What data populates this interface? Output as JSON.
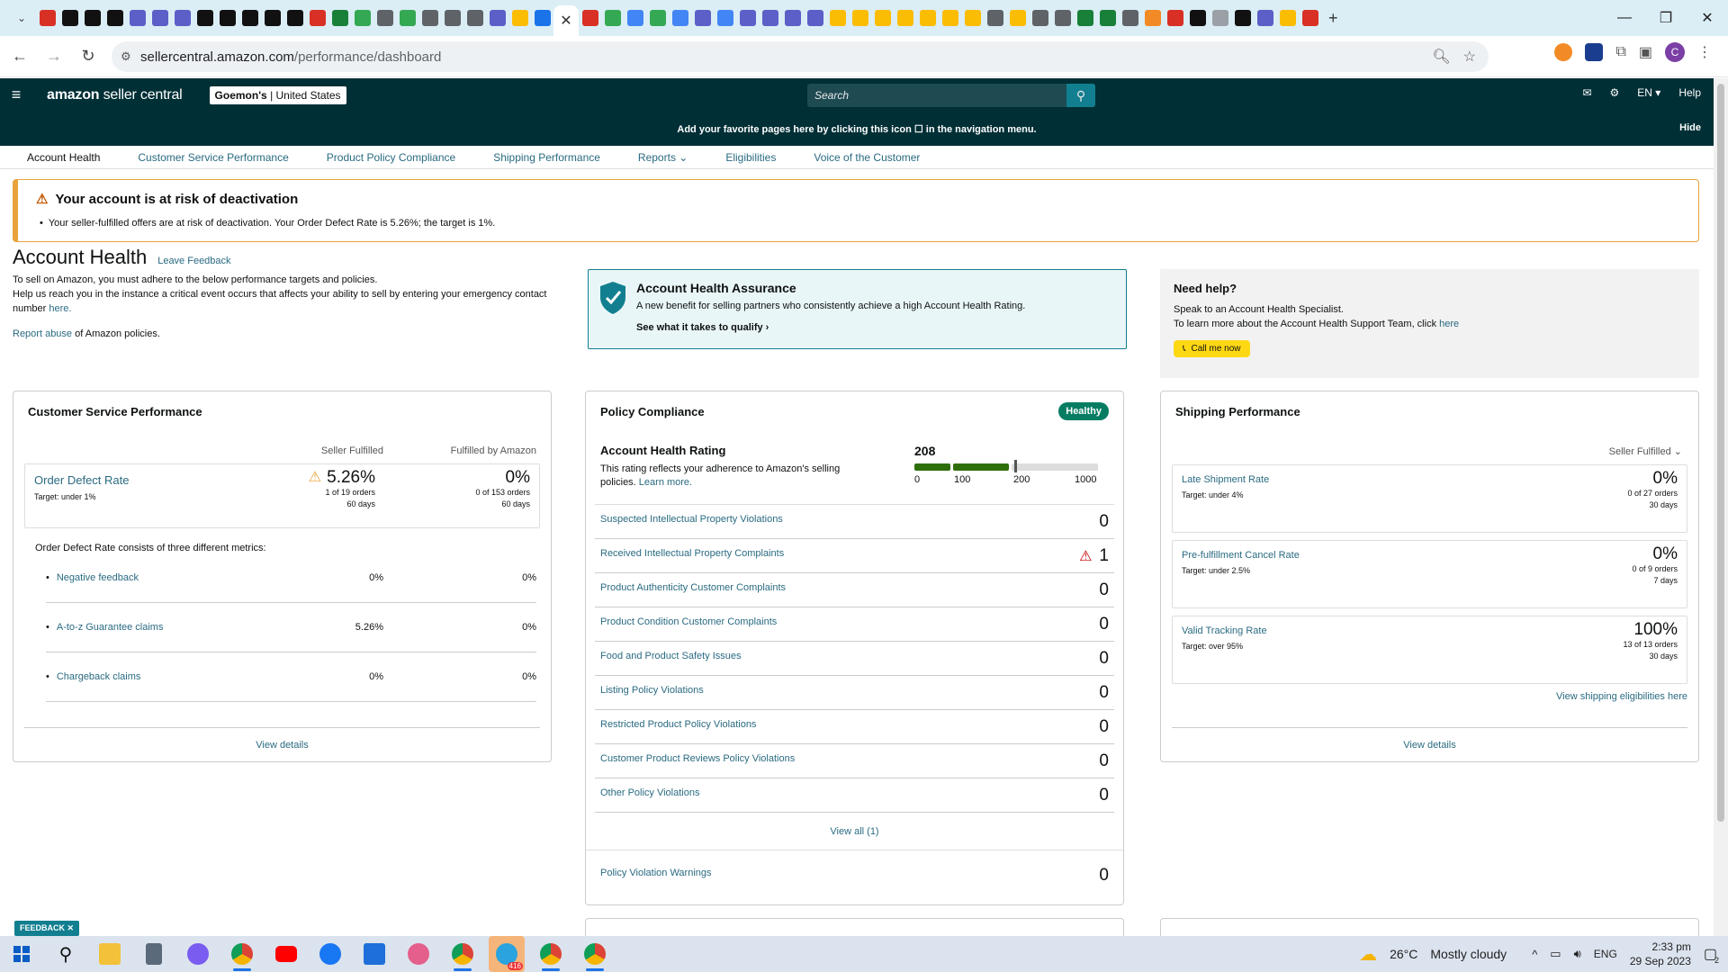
{
  "browser": {
    "active_tab_close": "✕",
    "url_host": "sellercentral.amazon.com",
    "url_path": "/performance/dashboard",
    "profile_initial": "C"
  },
  "header": {
    "logo_bold": "amazon",
    "logo_rest": " seller central",
    "store_name": "Goemon's",
    "store_region": " | United States",
    "search_placeholder": "Search",
    "lang": "EN ▾",
    "help": "Help",
    "fav_message": "Add your favorite pages here by clicking this icon ☐ in the navigation menu.",
    "fav_hide": "Hide"
  },
  "subnav": [
    "Account Health",
    "Customer Service Performance",
    "Product Policy Compliance",
    "Shipping Performance",
    "Reports  ⌄",
    "Eligibilities",
    "Voice of the Customer"
  ],
  "alert": {
    "title": "Your account is at risk of deactivation",
    "text": "Your seller-fulfilled offers are at risk of deactivation. Your Order Defect Rate is 5.26%; the target is 1%."
  },
  "account_health": {
    "title": "Account Health",
    "leave_feedback": "Leave Feedback",
    "desc1": "To sell on Amazon, you must adhere to the below performance targets and policies.",
    "desc2": "Help us reach you in the instance a critical event occurs that affects your ability to sell by entering your emergency contact number ",
    "desc2_link": "here.",
    "report_link": "Report abuse",
    "report_rest": " of Amazon policies."
  },
  "assurance": {
    "title": "Account Health Assurance",
    "desc": "A new benefit for selling partners who consistently achieve a high Account Health Rating.",
    "link": "See what it takes to qualify ›"
  },
  "help": {
    "title": "Need help?",
    "line1": "Speak to an Account Health Specialist.",
    "line2": "To learn more about the Account Health Support Team, click ",
    "line2_link": "here",
    "button": "Call me now"
  },
  "csp": {
    "title": "Customer Service Performance",
    "col1": "Seller Fulfilled",
    "col2": "Fulfilled by Amazon",
    "odr_name": "Order Defect Rate",
    "odr_target": "Target: under 1%",
    "sf_value": "5.26%",
    "sf_orders": "1 of 19 orders",
    "sf_days": "60 days",
    "fba_value": "0%",
    "fba_orders": "0 of 153 orders",
    "fba_days": "60 days",
    "consists": "Order Defect Rate consists of three different metrics:",
    "metrics": [
      {
        "name": "Negative feedback",
        "sf": "0%",
        "fba": "0%"
      },
      {
        "name": "A-to-z Guarantee claims",
        "sf": "5.26%",
        "fba": "0%"
      },
      {
        "name": "Chargeback claims",
        "sf": "0%",
        "fba": "0%"
      }
    ],
    "view_details": "View details"
  },
  "policy": {
    "title": "Policy Compliance",
    "badge": "Healthy",
    "ahr_title": "Account Health Rating",
    "ahr_desc": "This rating reflects your adherence to Amazon's selling policies. ",
    "ahr_learn": "Learn more.",
    "ahr_score": "208",
    "ahr_ticks": [
      "0",
      "100",
      "200",
      "1000"
    ],
    "rows": [
      {
        "name": "Suspected Intellectual Property Violations",
        "value": "0"
      },
      {
        "name": "Received Intellectual Property Complaints",
        "value": "1"
      },
      {
        "name": "Product Authenticity Customer Complaints",
        "value": "0"
      },
      {
        "name": "Product Condition Customer Complaints",
        "value": "0"
      },
      {
        "name": "Food and Product Safety Issues",
        "value": "0"
      },
      {
        "name": "Listing Policy Violations",
        "value": "0"
      },
      {
        "name": "Restricted Product Policy Violations",
        "value": "0"
      },
      {
        "name": "Customer Product Reviews Policy Violations",
        "value": "0"
      },
      {
        "name": "Other Policy Violations",
        "value": "0"
      }
    ],
    "view_all": "View all (1)",
    "warnings_name": "Policy Violation Warnings",
    "warnings_value": "0"
  },
  "shipping": {
    "title": "Shipping Performance",
    "selector": "Seller Fulfilled  ⌄",
    "metrics": [
      {
        "name": "Late Shipment Rate",
        "target": "Target: under 4%",
        "value": "0%",
        "orders": "0 of 27 orders",
        "days": "30 days"
      },
      {
        "name": "Pre-fulfillment Cancel Rate",
        "target": "Target: under 2.5%",
        "value": "0%",
        "orders": "0 of 9 orders",
        "days": "7 days"
      },
      {
        "name": "Valid Tracking Rate",
        "target": "Target: over 95%",
        "value": "100%",
        "orders": "13 of 13 orders",
        "days": "30 days"
      }
    ],
    "eligibilities_link": "View shipping eligibilities here",
    "view_details": "View details"
  },
  "feedback_tab": "FEEDBACK ✕",
  "taskbar": {
    "telegram_badge": "416",
    "weather_temp": "26°C",
    "weather_text": "Mostly cloudy",
    "lang": "ENG",
    "time": "2:33 pm",
    "date": "29 Sep 2023",
    "notif_count": "2"
  }
}
